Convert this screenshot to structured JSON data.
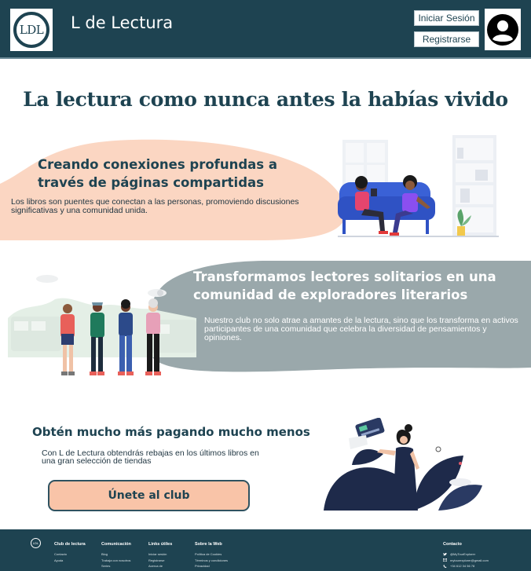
{
  "header": {
    "logo_text": "LDL",
    "title": "L de Lectura",
    "login_label": "Iniciar Sesión",
    "register_label": "Registrarse"
  },
  "hero": {
    "title": "La lectura como nunca antes la habías vivido"
  },
  "section1": {
    "title": "Creando conexiones profundas a través de páginas compartidas",
    "text": "Los libros son puentes que conectan a las personas, promoviendo discusiones significativas y una comunidad unida."
  },
  "section2": {
    "title": "Transformamos lectores solitarios en una comunidad de exploradores literarios",
    "text": "Nuestro club no solo atrae a amantes de la lectura, sino que los transforma en activos participantes de una comunidad que celebra la diversidad de pensamientos y opiniones."
  },
  "section3": {
    "title": "Obtén mucho más pagando mucho menos",
    "text": "Con L de Lectura obtendrás rebajas en los últimos libros en una gran selección de tiendas",
    "cta_label": "Únete al club"
  },
  "footer": {
    "logo_text": "LDL",
    "columns": [
      {
        "title": "Club de lectura",
        "links": [
          "Contacto",
          "Ayuda"
        ]
      },
      {
        "title": "Comunicación",
        "links": [
          "Blog",
          "Trabaja con nosotros",
          "Series"
        ]
      },
      {
        "title": "Links útiles",
        "links": [
          "Iniciar sesión",
          "Registrarse",
          "Acerca de"
        ]
      },
      {
        "title": "Sobre la Web",
        "links": [
          "Política de Cookies",
          "Términos y condiciones",
          "Privacidad"
        ]
      }
    ],
    "contact": {
      "title": "Contacto",
      "twitter": "@MyTourExplorer",
      "email": "mytourexplorer@gmail.com",
      "phone": "+34 612 34 56 78"
    }
  },
  "colors": {
    "primary": "#1e4351",
    "peach": "#fbd6c2",
    "slate": "#9aa8ab",
    "cta": "#f9c4a8"
  }
}
